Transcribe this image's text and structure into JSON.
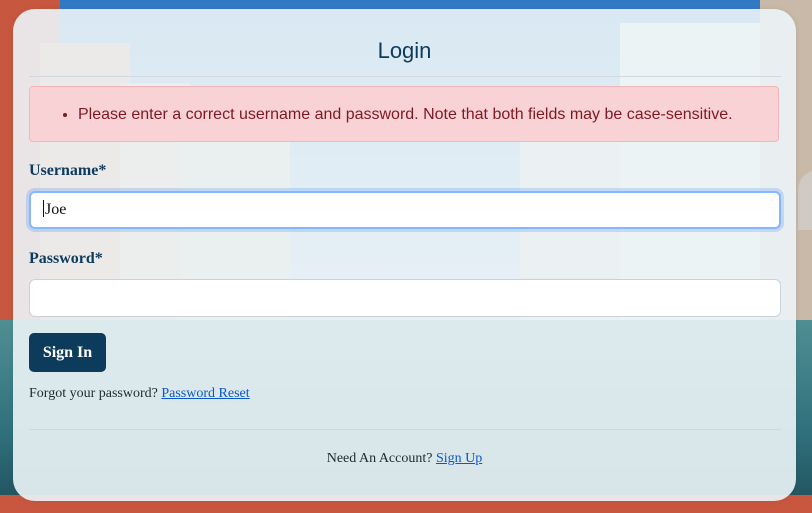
{
  "login": {
    "title": "Login",
    "error_message": "Please enter a correct username and password. Note that both fields may be case-sensitive.",
    "username_label": "Username*",
    "username_value": "Joe",
    "password_label": "Password*",
    "password_value": "",
    "submit_label": "Sign In",
    "forgot_text": "Forgot your password?",
    "reset_link": "Password Reset",
    "account_text": "Need An Account?",
    "signup_link": "Sign Up"
  },
  "colors": {
    "primary": "#0d3b5c",
    "alert_bg": "#f8d2d5",
    "alert_text": "#7d1a22",
    "link": "#0a58ca"
  }
}
